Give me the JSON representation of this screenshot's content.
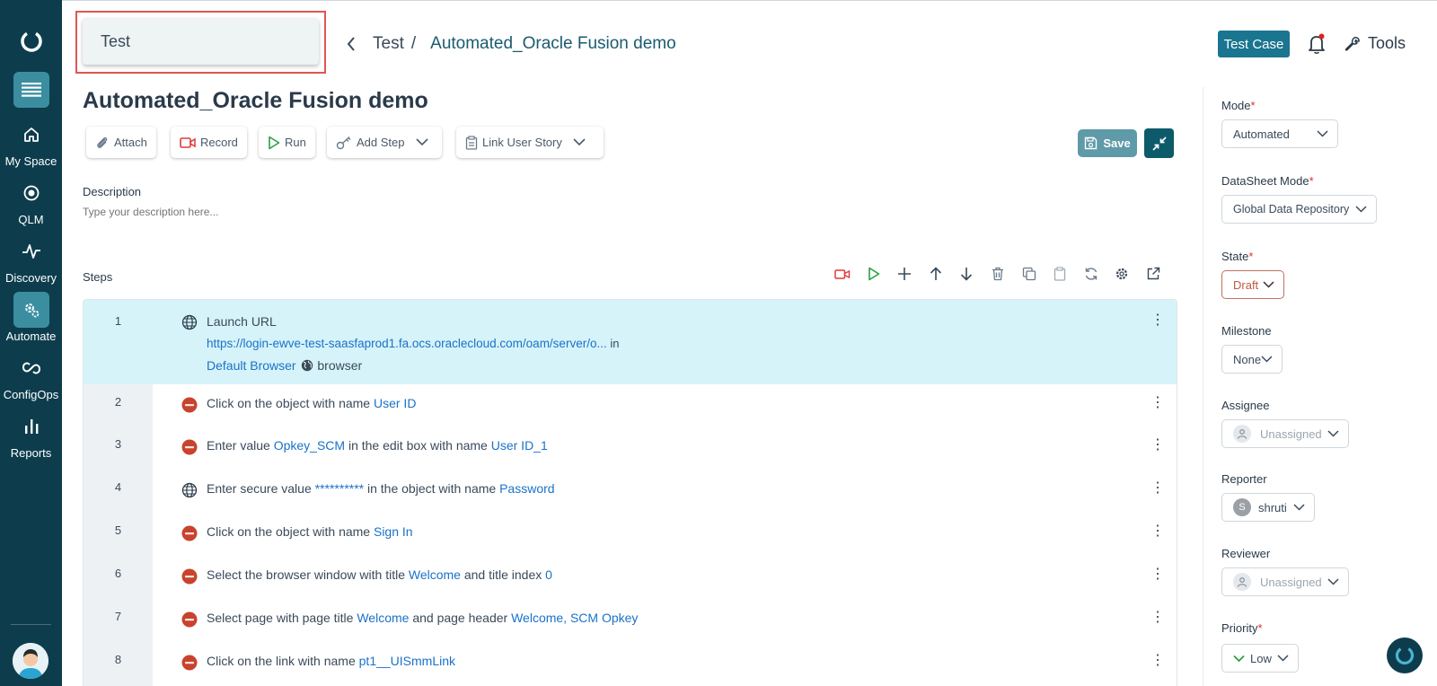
{
  "sidebar": {
    "items": [
      {
        "label": "My Space",
        "icon": "home-icon"
      },
      {
        "label": "QLM",
        "icon": "target-icon"
      },
      {
        "label": "Discovery",
        "icon": "pulse-icon"
      },
      {
        "label": "Automate",
        "icon": "gears-icon"
      },
      {
        "label": "ConfigOps",
        "icon": "link-icon"
      },
      {
        "label": "Reports",
        "icon": "bar-chart-icon"
      }
    ],
    "active": "Automate"
  },
  "header": {
    "tab_label": "Test",
    "breadcrumb_parent": "Test",
    "breadcrumb_separator": "/",
    "breadcrumb_current": "Automated_Oracle Fusion demo",
    "badge": "Test Case",
    "tools_label": "Tools"
  },
  "page_title": "Automated_Oracle Fusion demo",
  "toolbar": {
    "attach": "Attach",
    "record": "Record",
    "run": "Run",
    "add_step": "Add Step",
    "link_user_story": "Link User Story",
    "save": "Save"
  },
  "description": {
    "label": "Description",
    "placeholder": "Type your description here..."
  },
  "steps": {
    "label": "Steps",
    "rows": [
      {
        "num": "1",
        "icon": "globe",
        "parts": [
          [
            "t",
            "Launch URL"
          ]
        ],
        "line2": [
          [
            "v",
            "https://login-ewve-test-saasfaprod1.fa.ocs.oraclecloud.com/oam/server/o..."
          ],
          [
            "t",
            "  in"
          ]
        ],
        "line3": [
          [
            "v",
            "Default Browser"
          ],
          [
            "t",
            " browser"
          ]
        ]
      },
      {
        "num": "2",
        "icon": "fusion",
        "parts": [
          [
            "t",
            "Click on the object with name "
          ],
          [
            "v",
            "User ID"
          ]
        ]
      },
      {
        "num": "3",
        "icon": "fusion",
        "parts": [
          [
            "t",
            "Enter value "
          ],
          [
            "v",
            "Opkey_SCM"
          ],
          [
            "t",
            " in the edit box with name "
          ],
          [
            "v",
            "User ID_1"
          ]
        ]
      },
      {
        "num": "4",
        "icon": "globe",
        "parts": [
          [
            "t",
            "Enter secure value "
          ],
          [
            "v",
            "**********"
          ],
          [
            "t",
            " in the object with name "
          ],
          [
            "v",
            "Password"
          ]
        ]
      },
      {
        "num": "5",
        "icon": "fusion",
        "parts": [
          [
            "t",
            "Click on the object with name "
          ],
          [
            "v",
            "Sign In"
          ]
        ]
      },
      {
        "num": "6",
        "icon": "fusion",
        "parts": [
          [
            "t",
            "Select the browser window with title "
          ],
          [
            "v",
            "Welcome"
          ],
          [
            "t",
            " and title index "
          ],
          [
            "v",
            "0"
          ]
        ]
      },
      {
        "num": "7",
        "icon": "fusion",
        "parts": [
          [
            "t",
            "Select page with page title "
          ],
          [
            "v",
            "Welcome"
          ],
          [
            "t",
            " and page header "
          ],
          [
            "v",
            "Welcome, SCM Opkey"
          ]
        ]
      },
      {
        "num": "8",
        "icon": "fusion",
        "parts": [
          [
            "t",
            "Click on the link with name "
          ],
          [
            "v",
            "pt1__UISmmLink"
          ]
        ]
      }
    ]
  },
  "right_panel": {
    "mode_label": "Mode",
    "mode_value": "Automated",
    "datasheet_label": "DataSheet Mode",
    "datasheet_value": "Global Data Repository",
    "state_label": "State",
    "state_value": "Draft",
    "milestone_label": "Milestone",
    "milestone_value": "None",
    "assignee_label": "Assignee",
    "assignee_value": "Unassigned",
    "reporter_label": "Reporter",
    "reporter_value": "shruti",
    "reporter_initial": "S",
    "reviewer_label": "Reviewer",
    "reviewer_value": "Unassigned",
    "priority_label": "Priority",
    "priority_value": "Low",
    "required_mark": "*"
  },
  "colors": {
    "sidebar_bg": "#0d3d4d",
    "accent": "#1a7590",
    "link_blue": "#1a72c8",
    "selected_row": "#d6f3fa",
    "required": "#e03030"
  }
}
